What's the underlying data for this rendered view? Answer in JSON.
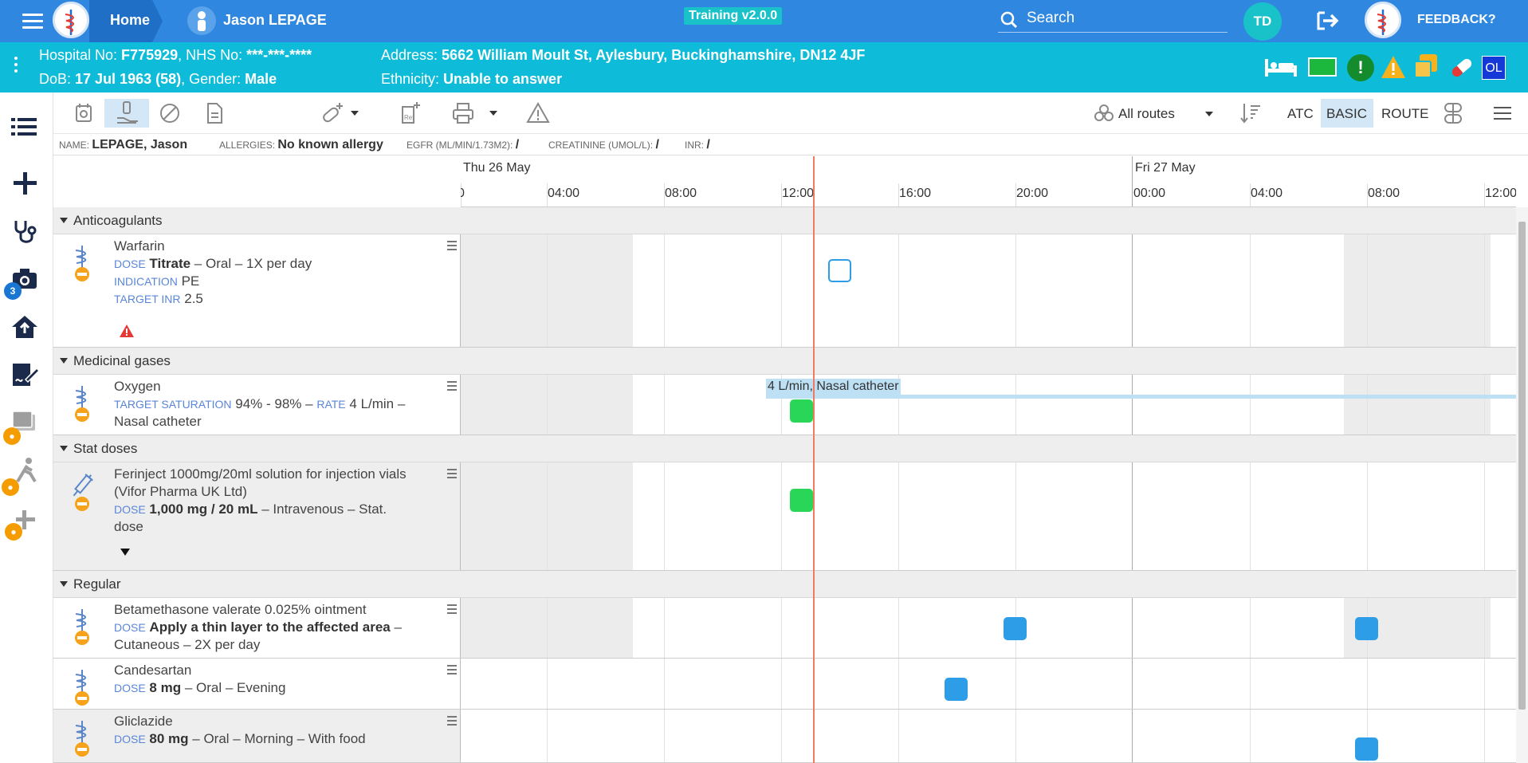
{
  "topbar": {
    "home_label": "Home",
    "patient_name": "Jason LEPAGE",
    "version": "Training v2.0.0",
    "search_label": "Search",
    "user_initials": "TD",
    "feedback_label": "FEEDBACK?"
  },
  "banner": {
    "hospital_label": "Hospital No: ",
    "hospital_no": "F775929",
    "nhs_label": ", NHS No: ",
    "nhs_no": "***-***-****",
    "dob_label": "DoB: ",
    "dob": "17 Jul 1963 (58)",
    "gender_label": ", Gender: ",
    "gender": "Male",
    "address_label": "Address: ",
    "address": "5662 William Moult St, Aylesbury, Buckinghamshire, DN12 4JF",
    "ethnicity_label": "Ethnicity: ",
    "ethnicity": "Unable to answer",
    "initials_chip": "OL"
  },
  "rail": {
    "camera_badge": "3"
  },
  "toolbar": {
    "routes_label": "All routes",
    "atc_label": "ATC",
    "basic_label": "BASIC",
    "route_label": "ROUTE"
  },
  "infostrip": {
    "name_label": "NAME:",
    "name_value": "LEPAGE, Jason",
    "allergies_label": "ALLERGIES:",
    "allergies_value": "No known allergy",
    "egfr_label": "EGFR (ML/MIN/1.73M2):",
    "egfr_value": "/",
    "creatinine_label": "CREATININE (UMOL/L):",
    "creatinine_value": "/",
    "inr_label": "INR:",
    "inr_value": "/"
  },
  "timeline": {
    "day1": "Thu 26 May",
    "day2": "Fri 27 May",
    "hours": [
      "0",
      "04:00",
      "08:00",
      "12:00",
      "16:00",
      "20:00",
      "00:00",
      "04:00",
      "08:00",
      "12:00"
    ]
  },
  "groups": {
    "anticoagulants": "Anticoagulants",
    "medicinal_gases": "Medicinal gases",
    "stat_doses": "Stat doses",
    "regular": "Regular"
  },
  "meds": {
    "warfarin": {
      "name": "Warfarin",
      "dose_label": "DOSE",
      "dose": "Titrate",
      "detail": " – Oral – 1X per day",
      "indication_label": "INDICATION",
      "indication": "PE",
      "target_label": "TARGET INR",
      "target": "2.5"
    },
    "oxygen": {
      "name": "Oxygen",
      "target_label": "TARGET SATURATION",
      "target": "94% - 98% –",
      "rate_label": "RATE",
      "rate": "4 L/min –",
      "detail": "Nasal catheter",
      "infusion_label": "4 L/min, Nasal catheter"
    },
    "ferinject": {
      "name": "Ferinject 1000mg/20ml solution for injection vials (Vifor Pharma UK Ltd)",
      "dose_label": "DOSE",
      "dose": "1,000 mg / 20 mL",
      "detail": " – Intravenous – Stat. dose"
    },
    "betamethasone": {
      "name": "Betamethasone valerate 0.025% ointment",
      "dose_label": "DOSE",
      "dose": "Apply a thin layer to the affected area",
      "detail": " – Cutaneous – 2X per day"
    },
    "candesartan": {
      "name": "Candesartan",
      "dose_label": "DOSE",
      "dose": "8 mg",
      "detail": " – Oral – Evening"
    },
    "gliclazide": {
      "name": "Gliclazide",
      "dose_label": "DOSE",
      "dose": "80 mg",
      "detail": " – Oral – Morning – With food"
    }
  },
  "colors": {
    "topbar": "#2f87e0",
    "banner": "#0ebcd9",
    "administered": "#29d657",
    "scheduled": "#2c9de6",
    "now_line": "#f07b5f",
    "warning": "#e53935"
  }
}
